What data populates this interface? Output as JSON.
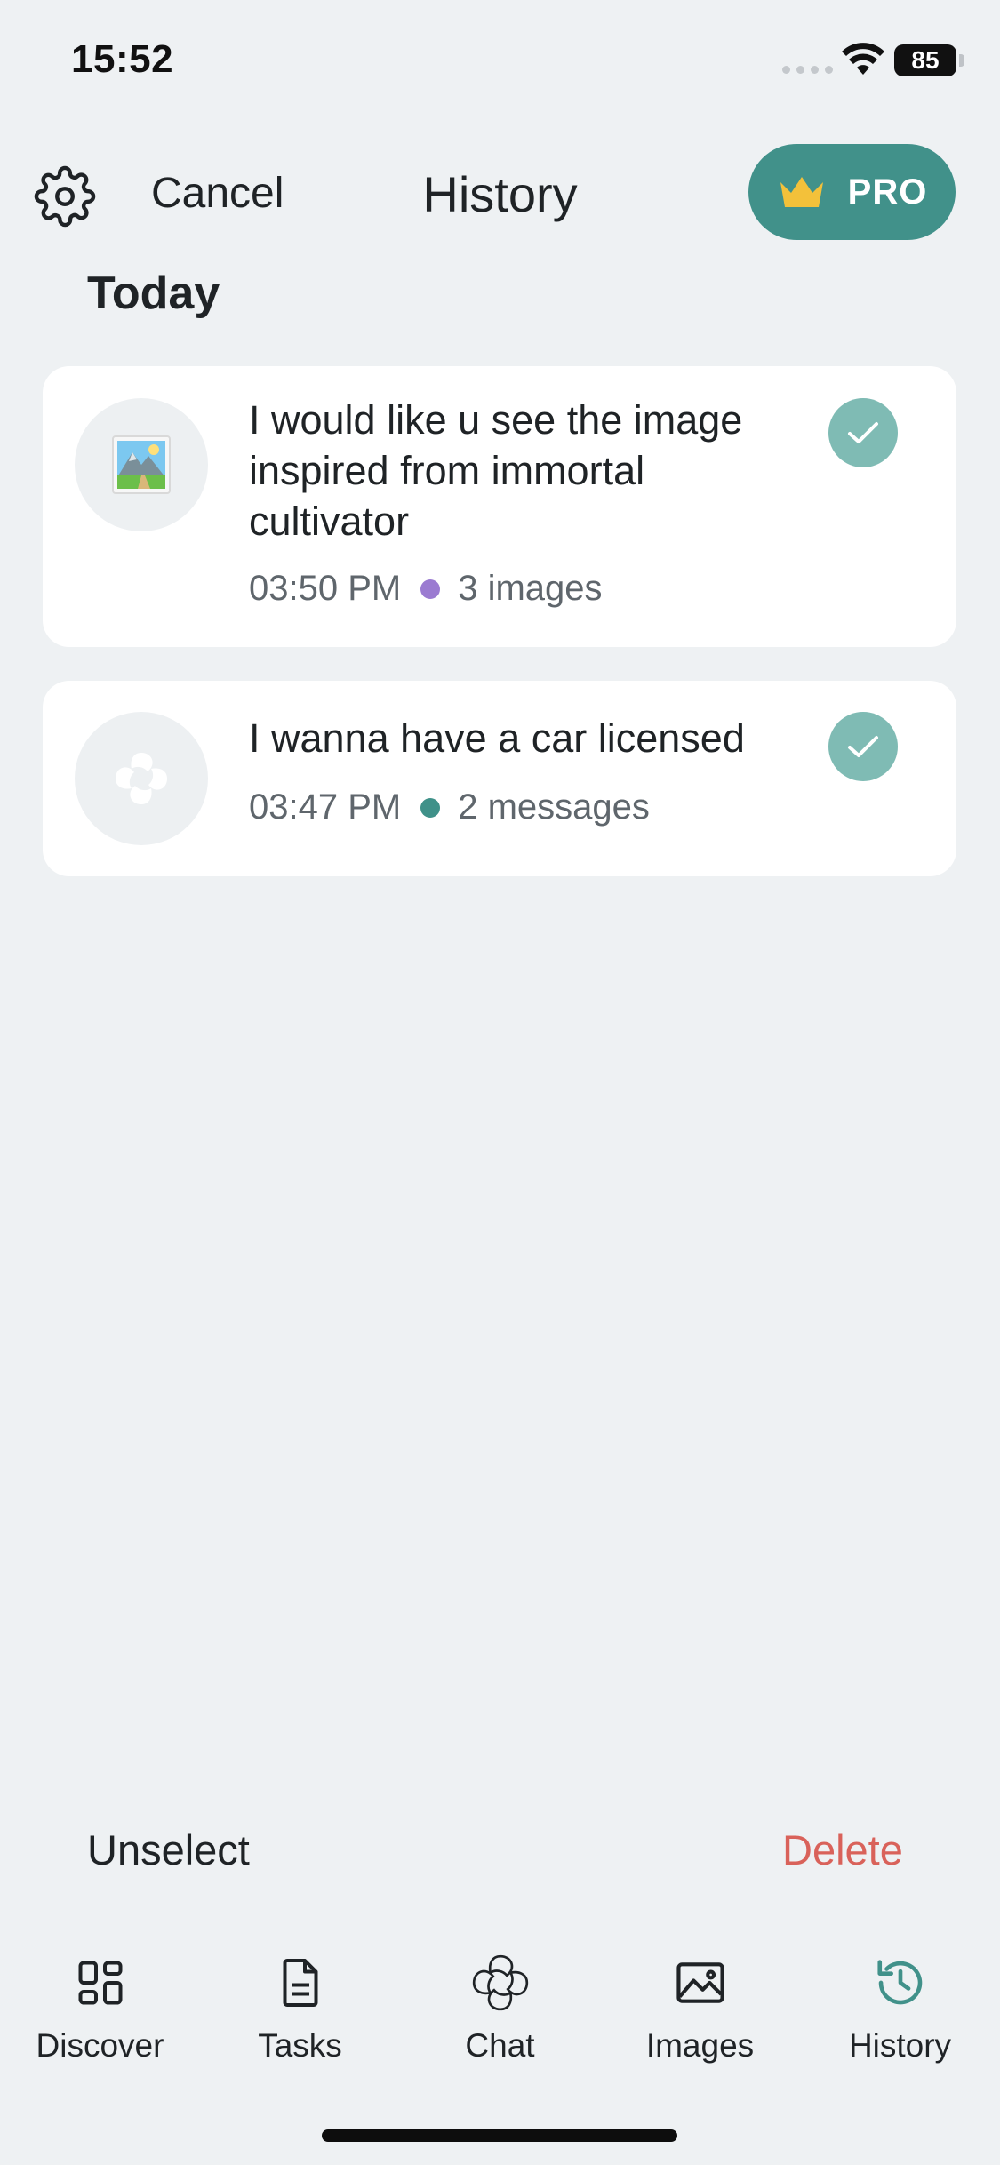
{
  "status_bar": {
    "time": "15:52",
    "battery": "85"
  },
  "header": {
    "cancel_label": "Cancel",
    "title": "History",
    "pro_label": "PRO"
  },
  "section_title": "Today",
  "items": [
    {
      "title_lines": [
        "I would like u see the image",
        "inspired from immortal",
        "cultivator"
      ],
      "time": "03:50 PM",
      "count_label": "3 images",
      "dot_color": "#9b7bd1",
      "thumb_icon": "landscape-image-icon",
      "selected": true
    },
    {
      "title_lines": [
        "I wanna have a car licensed"
      ],
      "time": "03:47 PM",
      "count_label": "2 messages",
      "dot_color": "#3f9189",
      "thumb_icon": "chat-swirl-icon",
      "selected": true
    }
  ],
  "actions": {
    "unselect_label": "Unselect",
    "delete_label": "Delete"
  },
  "tabs": [
    {
      "label": "Discover",
      "icon": "grid-icon"
    },
    {
      "label": "Tasks",
      "icon": "document-icon"
    },
    {
      "label": "Chat",
      "icon": "swirl-icon"
    },
    {
      "label": "Images",
      "icon": "image-icon"
    },
    {
      "label": "History",
      "icon": "history-icon",
      "active": true
    }
  ],
  "colors": {
    "accent": "#41918a",
    "delete": "#d9625a",
    "check": "#7fbbb4",
    "background": "#eef1f3"
  }
}
